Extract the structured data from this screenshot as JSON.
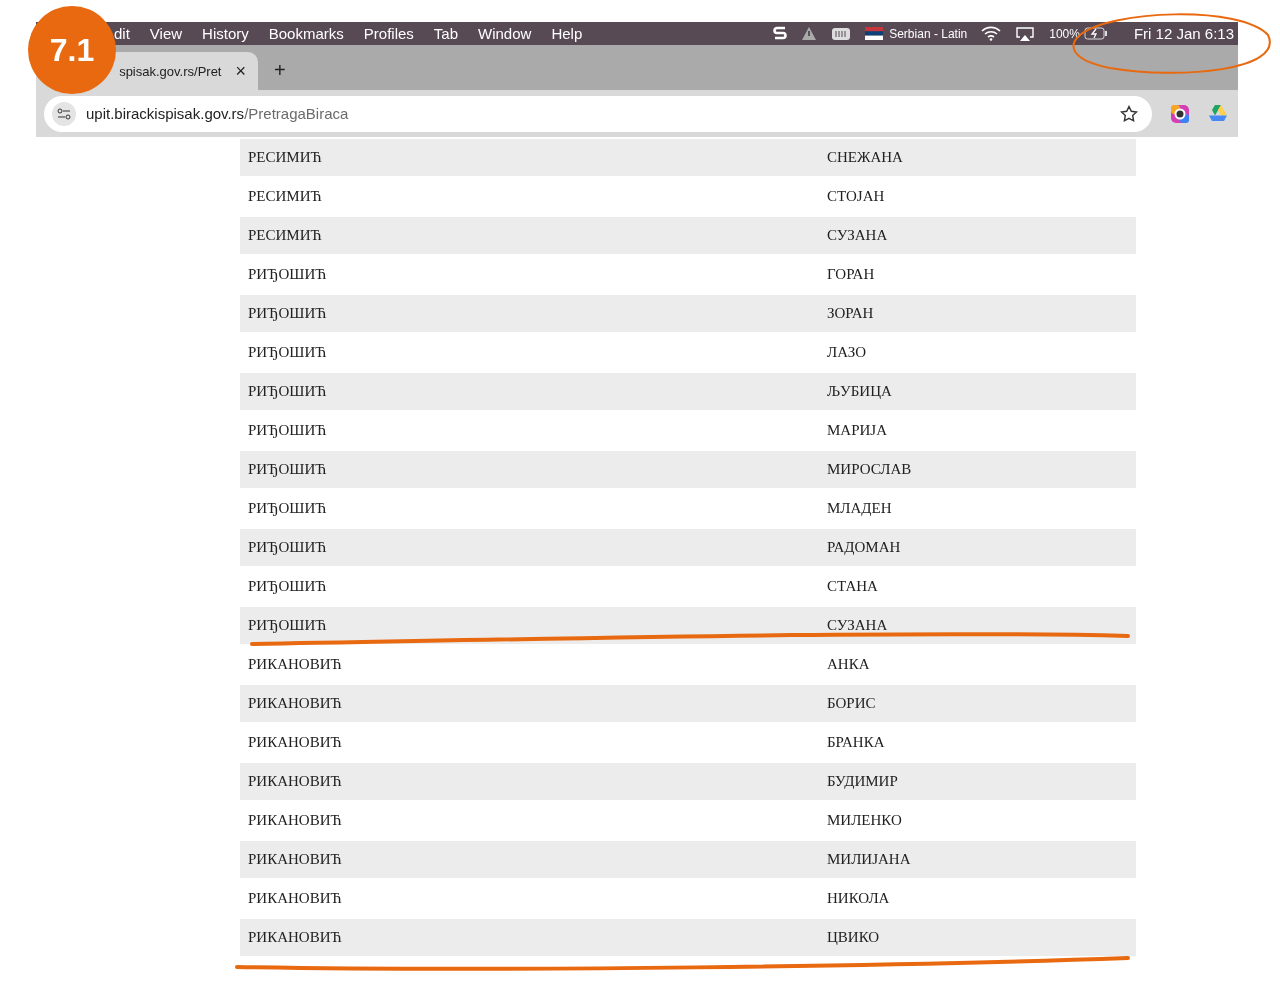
{
  "annotation": {
    "badge": "7.1"
  },
  "menu_bar": {
    "items": [
      "dit",
      "View",
      "History",
      "Bookmarks",
      "Profiles",
      "Tab",
      "Window",
      "Help"
    ],
    "input_source": "Serbian - Latin",
    "battery": "100%",
    "clock": "Fri 12 Jan  6:13"
  },
  "tabs": [
    {
      "title": "spisak.gov.rs/Pret",
      "close": "×",
      "selected": true
    }
  ],
  "new_tab": "+",
  "address_bar": {
    "host": "upit.birackispisak.gov.rs",
    "path": "/PretragaBiraca"
  },
  "table": {
    "rows": [
      {
        "surname": "РЕСИМИЋ",
        "name": "СНЕЖАНА"
      },
      {
        "surname": "РЕСИМИЋ",
        "name": "СТОЈАН"
      },
      {
        "surname": "РЕСИМИЋ",
        "name": "СУЗАНА"
      },
      {
        "surname": "РИЂОШИЋ",
        "name": "ГОРАН"
      },
      {
        "surname": "РИЂОШИЋ",
        "name": "ЗОРАН"
      },
      {
        "surname": "РИЂОШИЋ",
        "name": "ЛАЗО"
      },
      {
        "surname": "РИЂОШИЋ",
        "name": "ЉУБИЦА"
      },
      {
        "surname": "РИЂОШИЋ",
        "name": "МАРИЈА"
      },
      {
        "surname": "РИЂОШИЋ",
        "name": "МИРОСЛАВ"
      },
      {
        "surname": "РИЂОШИЋ",
        "name": "МЛАДЕН"
      },
      {
        "surname": "РИЂОШИЋ",
        "name": "РАДОМАН"
      },
      {
        "surname": "РИЂОШИЋ",
        "name": "СТАНА"
      },
      {
        "surname": "РИЂОШИЋ",
        "name": "СУЗАНА"
      },
      {
        "surname": "РИКАНОВИЋ",
        "name": "АНКА"
      },
      {
        "surname": "РИКАНОВИЋ",
        "name": "БОРИС"
      },
      {
        "surname": "РИКАНОВИЋ",
        "name": "БРАНКА"
      },
      {
        "surname": "РИКАНОВИЋ",
        "name": "БУДИМИР"
      },
      {
        "surname": "РИКАНОВИЋ",
        "name": "МИЛЕНКО"
      },
      {
        "surname": "РИКАНОВИЋ",
        "name": "МИЛИЈАНА"
      },
      {
        "surname": "РИКАНОВИЋ",
        "name": "НИКОЛА"
      },
      {
        "surname": "РИКАНОВИЋ",
        "name": "ЦВИКО"
      }
    ]
  }
}
